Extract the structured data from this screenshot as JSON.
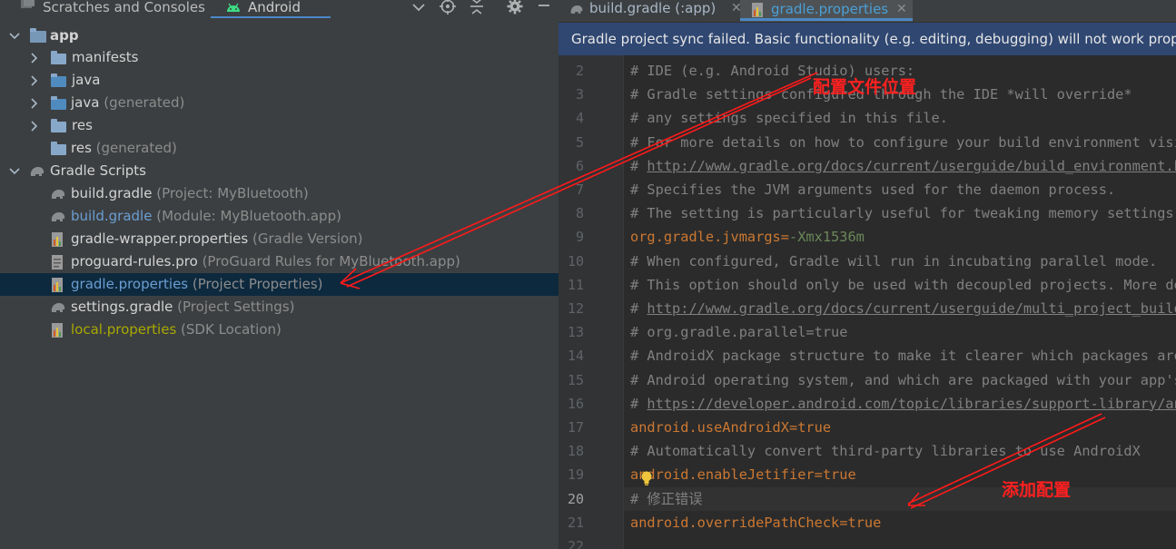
{
  "left_panel": {
    "tabs": {
      "scratches": "Scratches and Consoles",
      "android": "Android"
    },
    "tree": [
      {
        "name": "app",
        "hint": "",
        "level": 0,
        "expanded": true
      },
      {
        "name": "manifests",
        "hint": "",
        "level": 1,
        "expanded": false
      },
      {
        "name": "java",
        "hint": "",
        "level": 1,
        "expanded": false
      },
      {
        "name": "java",
        "hint": "(generated)",
        "level": 1,
        "expanded": false
      },
      {
        "name": "res",
        "hint": "",
        "level": 1,
        "expanded": false
      },
      {
        "name": "res",
        "hint": "(generated)",
        "level": 1,
        "expanded": false
      },
      {
        "name": "Gradle Scripts",
        "hint": "",
        "level": 0,
        "expanded": true
      },
      {
        "name": "build.gradle",
        "hint": "(Project: MyBluetooth)",
        "level": 1
      },
      {
        "name": "build.gradle",
        "hint": "(Module: MyBluetooth.app)",
        "level": 1
      },
      {
        "name": "gradle-wrapper.properties",
        "hint": "(Gradle Version)",
        "level": 1
      },
      {
        "name": "proguard-rules.pro",
        "hint": "(ProGuard Rules for MyBluetooth.app)",
        "level": 1
      },
      {
        "name": "gradle.properties",
        "hint": "(Project Properties)",
        "level": 1,
        "selected": true
      },
      {
        "name": "settings.gradle",
        "hint": "(Project Settings)",
        "level": 1
      },
      {
        "name": "local.properties",
        "hint": "(SDK Location)",
        "level": 1
      }
    ]
  },
  "editor": {
    "tabs": [
      {
        "label": "build.gradle (:app)",
        "active": false
      },
      {
        "label": "gradle.properties",
        "active": true
      }
    ],
    "banner": "Gradle project sync failed. Basic functionality (e.g. editing, debugging) will not work properly.",
    "current_line": 20,
    "lines": [
      {
        "n": "2",
        "text": "# IDE (e.g. Android Studio) users:"
      },
      {
        "n": "3",
        "text": "# Gradle settings configured through the IDE *will override*"
      },
      {
        "n": "4",
        "text": "# any settings specified in this file."
      },
      {
        "n": "5",
        "text": "# For more details on how to configure your build environment visit"
      },
      {
        "n": "6",
        "pre": "# ",
        "link": "http://www.gradle.org/docs/current/userguide/build_environment.html"
      },
      {
        "n": "7",
        "text": "# Specifies the JVM arguments used for the daemon process."
      },
      {
        "n": "8",
        "text": "# The setting is particularly useful for tweaking memory settings."
      },
      {
        "n": "9",
        "key": "org.gradle.jvmargs",
        "value": "-Xmx1536m"
      },
      {
        "n": "10",
        "text": "# When configured, Gradle will run in incubating parallel mode."
      },
      {
        "n": "11",
        "text": "# This option should only be used with decoupled projects. More details, visit"
      },
      {
        "n": "12",
        "pre": "# ",
        "link": "http://www.gradle.org/docs/current/userguide/multi_project_builds.html"
      },
      {
        "n": "13",
        "text": "# org.gradle.parallel=true"
      },
      {
        "n": "14",
        "text": "# AndroidX package structure to make it clearer which packages are bundled with the"
      },
      {
        "n": "15",
        "text": "# Android operating system, and which are packaged with your app's APK"
      },
      {
        "n": "16",
        "pre": "# ",
        "link": "https://developer.android.com/topic/libraries/support-library/androidx-rn"
      },
      {
        "n": "17",
        "key": "android.useAndroidX",
        "value": "true"
      },
      {
        "n": "18",
        "text": "# Automatically convert third-party libraries to use AndroidX"
      },
      {
        "n": "19",
        "key": "android.enableJetifier",
        "value": "true"
      },
      {
        "n": "20",
        "text": "# 修正错误"
      },
      {
        "n": "21",
        "key": "android.overridePathCheck",
        "value": "true"
      },
      {
        "n": "22",
        "text": ""
      }
    ]
  },
  "annotations": {
    "config_location": "配置文件位置",
    "add_config": "添加配置"
  }
}
